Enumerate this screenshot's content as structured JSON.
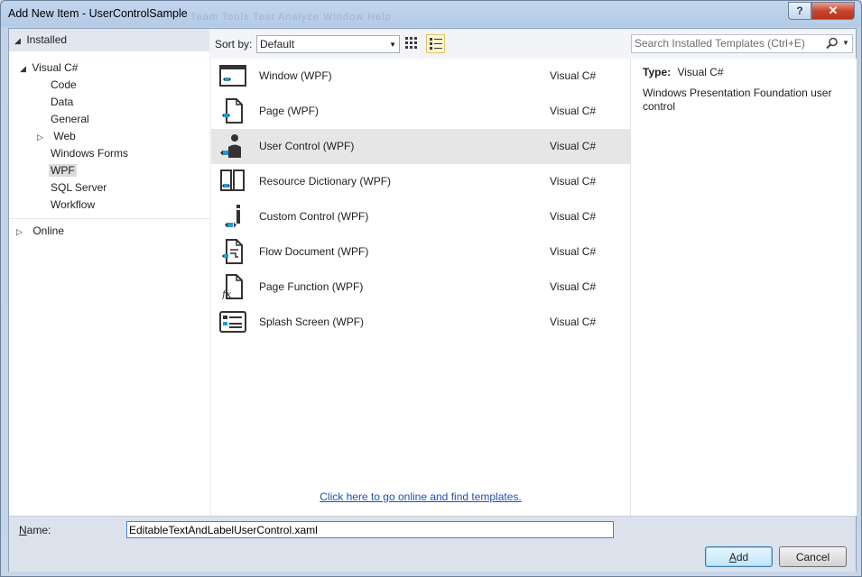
{
  "window": {
    "title": "Add New Item - UserControlSample",
    "ghost_menu": "Team   Tools   Test   Analyze   Window   Help",
    "help_glyph": "?",
    "close_glyph": "✕"
  },
  "left": {
    "header": "Installed",
    "visual_csharp": "Visual C#",
    "items": [
      "Code",
      "Data",
      "General",
      "Web",
      "Windows Forms",
      "WPF",
      "SQL Server",
      "Workflow"
    ],
    "selected": "WPF",
    "online": "Online"
  },
  "toolbar": {
    "sort_label": "Sort by:",
    "sort_value": "Default"
  },
  "templates": [
    {
      "name": "Window (WPF)",
      "lang": "Visual C#",
      "icon": "window-icon"
    },
    {
      "name": "Page (WPF)",
      "lang": "Visual C#",
      "icon": "page-icon"
    },
    {
      "name": "User Control (WPF)",
      "lang": "Visual C#",
      "icon": "user-control-icon"
    },
    {
      "name": "Resource Dictionary (WPF)",
      "lang": "Visual C#",
      "icon": "resource-dictionary-icon"
    },
    {
      "name": "Custom Control (WPF)",
      "lang": "Visual C#",
      "icon": "custom-control-icon"
    },
    {
      "name": "Flow Document (WPF)",
      "lang": "Visual C#",
      "icon": "flow-document-icon"
    },
    {
      "name": "Page Function (WPF)",
      "lang": "Visual C#",
      "icon": "page-function-icon"
    },
    {
      "name": "Splash Screen (WPF)",
      "lang": "Visual C#",
      "icon": "splash-screen-icon"
    }
  ],
  "selected_template": "User Control (WPF)",
  "online_link": "Click here to go online and find templates.",
  "search": {
    "placeholder": "Search Installed Templates (Ctrl+E)"
  },
  "details": {
    "type_label": "Type:",
    "type_value": "Visual C#",
    "description": "Windows Presentation Foundation user control"
  },
  "bottom": {
    "name_label": "Name:",
    "name_value": "EditableTextAndLabelUserControl.xaml",
    "add_label": "Add",
    "cancel_label": "Cancel"
  },
  "colors": {
    "accent_blue": "#1e9ad6",
    "link": "#1f4fb5",
    "selection": "#e6e6e6"
  }
}
